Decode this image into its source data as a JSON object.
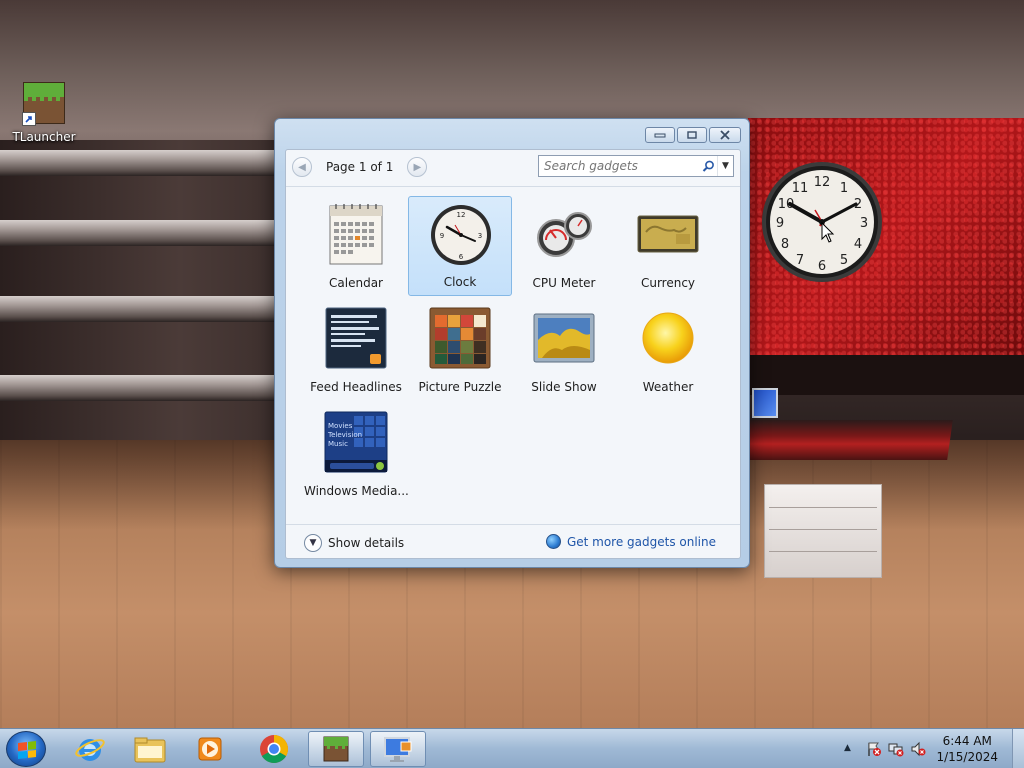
{
  "desktop": {
    "icons": [
      {
        "label": "TLauncher",
        "icon": "minecraft-grass-block-icon"
      }
    ]
  },
  "gadget_window": {
    "pager": {
      "label": "Page 1 of 1"
    },
    "search": {
      "placeholder": "Search gadgets",
      "value": ""
    },
    "gadgets": [
      {
        "label": "Calendar",
        "icon": "calendar-icon",
        "selected": false
      },
      {
        "label": "Clock",
        "icon": "clock-icon",
        "selected": true
      },
      {
        "label": "CPU Meter",
        "icon": "cpu-meter-icon",
        "selected": false
      },
      {
        "label": "Currency",
        "icon": "currency-icon",
        "selected": false
      },
      {
        "label": "Feed Headlines",
        "icon": "feed-headlines-icon",
        "selected": false
      },
      {
        "label": "Picture Puzzle",
        "icon": "picture-puzzle-icon",
        "selected": false
      },
      {
        "label": "Slide Show",
        "icon": "slide-show-icon",
        "selected": false
      },
      {
        "label": "Weather",
        "icon": "weather-sun-icon",
        "selected": false
      },
      {
        "label": "Windows Media...",
        "icon": "windows-media-icon",
        "selected": false
      }
    ],
    "calendar_thumb": {
      "month": "OCT 06"
    },
    "media_thumb": {
      "lines": [
        "Movies",
        "Television",
        "Music"
      ]
    },
    "footer": {
      "details_label": "Show details",
      "more_label": "Get more gadgets online"
    }
  },
  "taskbar": {
    "pinned": [
      "internet-explorer-icon",
      "file-explorer-icon",
      "media-player-icon",
      "chrome-icon",
      "tlauncher-icon",
      "gadgets-icon"
    ],
    "clock": {
      "time": "6:44 AM",
      "date": "1/15/2024"
    }
  }
}
